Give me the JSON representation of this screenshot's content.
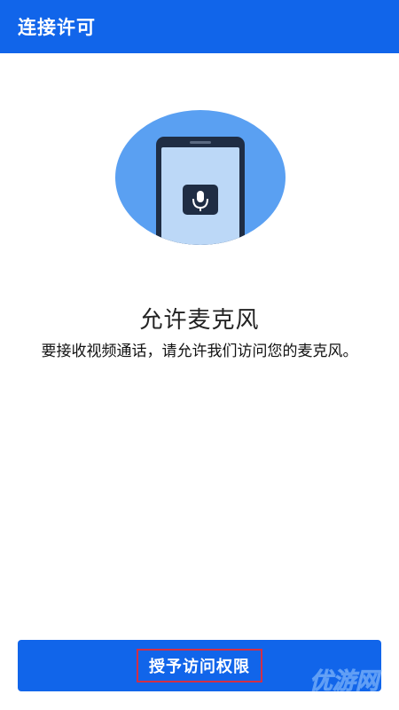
{
  "appbar": {
    "title": "连接许可"
  },
  "main": {
    "heading": "允许麦克风",
    "description": "要接收视频通话，请允许我们访问您的麦克风。",
    "illustration_icon": "microphone-icon"
  },
  "footer": {
    "grant_button_label": "授予访问权限"
  },
  "watermark": {
    "text": "优游网"
  },
  "colors": {
    "primary": "#1165ea",
    "circle": "#5aa0f2",
    "phone_screen": "#bcd8f7",
    "phone_frame": "#1f2d44",
    "highlight_border": "#d32f45"
  }
}
